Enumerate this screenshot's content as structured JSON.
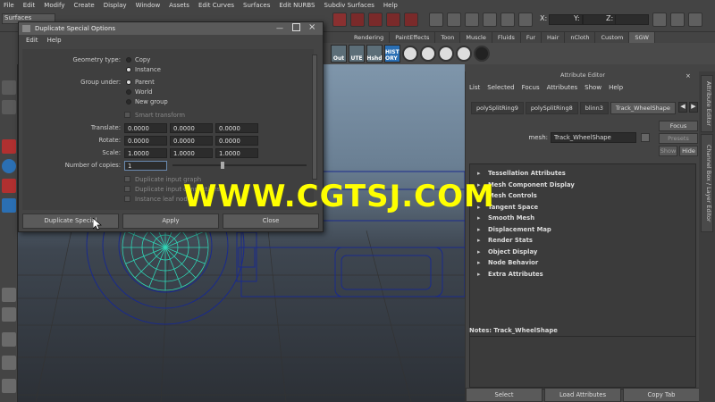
{
  "menubar": [
    "File",
    "Edit",
    "Modify",
    "Create",
    "Display",
    "Window",
    "Assets",
    "Edit Curves",
    "Surfaces",
    "Edit NURBS",
    "Subdiv Surfaces",
    "Help"
  ],
  "status": {
    "mode": "Surfaces",
    "x": "X:",
    "y": "Y:",
    "z": "Z:"
  },
  "shelf": {
    "tabs": [
      "Rendering",
      "PaintEffects",
      "Toon",
      "Muscle",
      "Fluids",
      "Fur",
      "Hair",
      "nCloth",
      "Custom",
      "SGW"
    ],
    "active_tab": "SGW",
    "icons": [
      "Out",
      "UTE",
      "Hshd",
      "HIST ORY"
    ]
  },
  "dialog": {
    "title": "Duplicate Special Options",
    "menu": [
      "Edit",
      "Help"
    ],
    "geometry_type_label": "Geometry type:",
    "geometry_options": [
      "Copy",
      "Instance"
    ],
    "group_under_label": "Group under:",
    "group_options": [
      "Parent",
      "World",
      "New group"
    ],
    "smart_transform": "Smart transform",
    "translate_label": "Translate:",
    "rotate_label": "Rotate:",
    "scale_label": "Scale:",
    "translate": [
      "0.0000",
      "0.0000",
      "0.0000"
    ],
    "rotate": [
      "0.0000",
      "0.0000",
      "0.0000"
    ],
    "scale": [
      "1.0000",
      "1.0000",
      "1.0000"
    ],
    "copies_label": "Number of copies:",
    "copies": "1",
    "checks": [
      "Duplicate input graph",
      "Duplicate input connections",
      "Instance leaf nodes"
    ],
    "buttons": [
      "Duplicate Special",
      "Apply",
      "Close"
    ]
  },
  "attr": {
    "title": "Attribute Editor",
    "menu": [
      "List",
      "Selected",
      "Focus",
      "Attributes",
      "Show",
      "Help"
    ],
    "tabs": [
      "polySplitRing9",
      "polySplitRing8",
      "blinn3",
      "Track_WheelShape"
    ],
    "active_tab": "Track_WheelShape",
    "mesh_label": "mesh:",
    "mesh_value": "Track_WheelShape",
    "focus": "Focus",
    "presets": "Presets",
    "show": "Show",
    "hide": "Hide",
    "sections": [
      "Tessellation Attributes",
      "Mesh Component Display",
      "Mesh Controls",
      "Tangent Space",
      "Smooth Mesh",
      "Displacement Map",
      "Render Stats",
      "Object Display",
      "Node Behavior",
      "Extra Attributes"
    ],
    "notes": "Notes: Track_WheelShape",
    "bottom_buttons": [
      "Select",
      "Load Attributes",
      "Copy Tab"
    ]
  },
  "side_tabs": [
    "Attribute Editor",
    "Channel Box / Layer Editor"
  ],
  "watermark": "WWW.CGTSJ.COM"
}
